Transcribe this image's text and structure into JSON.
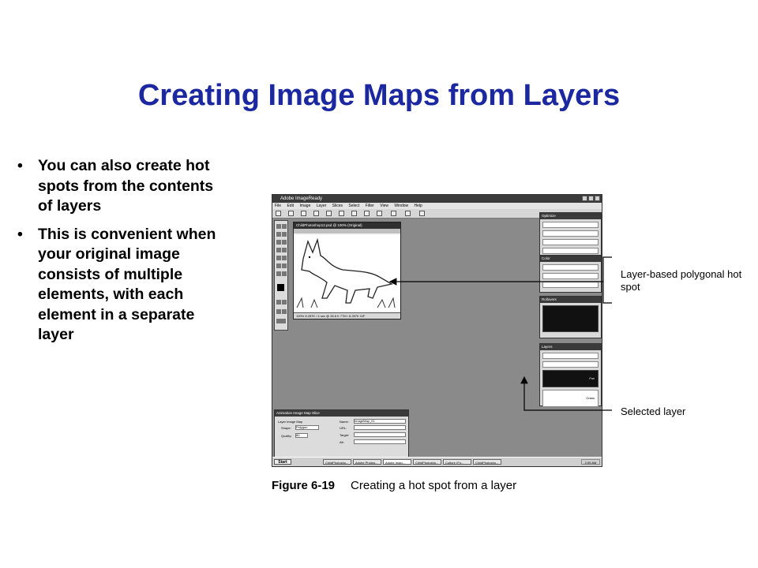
{
  "slide": {
    "title": "Creating Image Maps from Layers",
    "bullets": [
      "You can also create hot spots from the contents of layers",
      "This is convenient when your original image consists of multiple elements, with each element in a separate layer"
    ]
  },
  "screenshot": {
    "window_title": "Adobe ImageReady",
    "menu": [
      "File",
      "Edit",
      "Image",
      "Layer",
      "Slices",
      "Select",
      "Filter",
      "View",
      "Window",
      "Help"
    ],
    "document_title": "ChildPhotoshop12.psd @ 100% (Original)",
    "document_status": "100%   8.287K / 4 sec @ 28.8 K   77M / 8.287K GIF",
    "palettes": {
      "optimize": "Optimize",
      "color": "Color",
      "rollovers": "Rollovers",
      "layers": "Layers",
      "layer_names": [
        "Fox",
        "Grass"
      ]
    },
    "image_map_panel": {
      "tabs": "Animation  Image Map  Slice",
      "layer_image_map": "Layer Image Map",
      "shape_label": "Shape:",
      "shape_value": "Polygon",
      "quality_label": "Quality:",
      "quality_value": "80",
      "name_label": "Name:",
      "name_value": "ImageMap_01",
      "url_label": "URL:",
      "target_label": "Target:",
      "alt_label": "Alt:"
    },
    "taskbar": {
      "start": "Start",
      "tasks": [
        "ChildPhotosho...",
        "Adobe Photos...",
        "Adobe Imag...",
        "ChildPhotosho...",
        "Culture (Fo...",
        "ChildPhotosho..."
      ],
      "clock": "2:05 AM"
    }
  },
  "callouts": {
    "hotspot": "Layer-based polygonal hot spot",
    "selected_layer": "Selected layer"
  },
  "figure": {
    "number": "Figure 6-19",
    "caption": "Creating a hot spot from a layer"
  }
}
